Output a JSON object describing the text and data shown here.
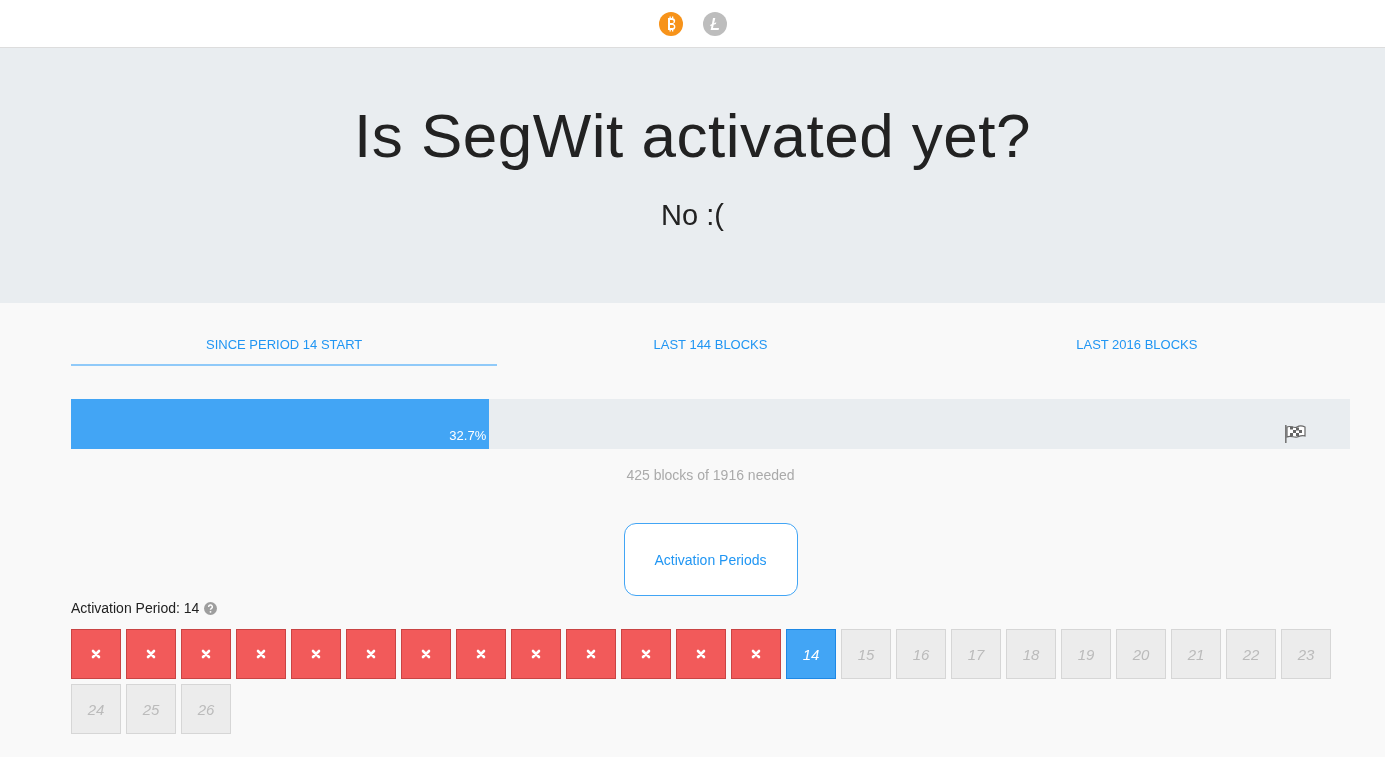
{
  "coins": [
    {
      "kind": "bitcoin",
      "selected": true
    },
    {
      "kind": "litecoin",
      "selected": false
    }
  ],
  "hero": {
    "title": "Is SegWit activated yet?",
    "answer": "No :("
  },
  "tabs": [
    {
      "label": "SINCE PERIOD 14 START",
      "selected": true
    },
    {
      "label": "LAST 144 BLOCKS",
      "selected": false
    },
    {
      "label": "LAST 2016 BLOCKS",
      "selected": false
    }
  ],
  "progress": {
    "level": 0.327,
    "reading": "32.7%",
    "caption": "425 blocks of 1916 needed"
  },
  "periods_button": "Activation Periods",
  "period_label": "Activation Period: 14",
  "periods": [
    {
      "kind": "failed"
    },
    {
      "kind": "failed"
    },
    {
      "kind": "failed"
    },
    {
      "kind": "failed"
    },
    {
      "kind": "failed"
    },
    {
      "kind": "failed"
    },
    {
      "kind": "failed"
    },
    {
      "kind": "failed"
    },
    {
      "kind": "failed"
    },
    {
      "kind": "failed"
    },
    {
      "kind": "failed"
    },
    {
      "kind": "failed"
    },
    {
      "kind": "failed"
    },
    {
      "kind": "current",
      "label": "14"
    },
    {
      "kind": "future",
      "label": "15"
    },
    {
      "kind": "future",
      "label": "16"
    },
    {
      "kind": "future",
      "label": "17"
    },
    {
      "kind": "future",
      "label": "18"
    },
    {
      "kind": "future",
      "label": "19"
    },
    {
      "kind": "future",
      "label": "20"
    },
    {
      "kind": "future",
      "label": "21"
    },
    {
      "kind": "future",
      "label": "22"
    },
    {
      "kind": "future",
      "label": "23"
    },
    {
      "kind": "future",
      "label": "24"
    },
    {
      "kind": "future",
      "label": "25"
    },
    {
      "kind": "future",
      "label": "26"
    }
  ]
}
